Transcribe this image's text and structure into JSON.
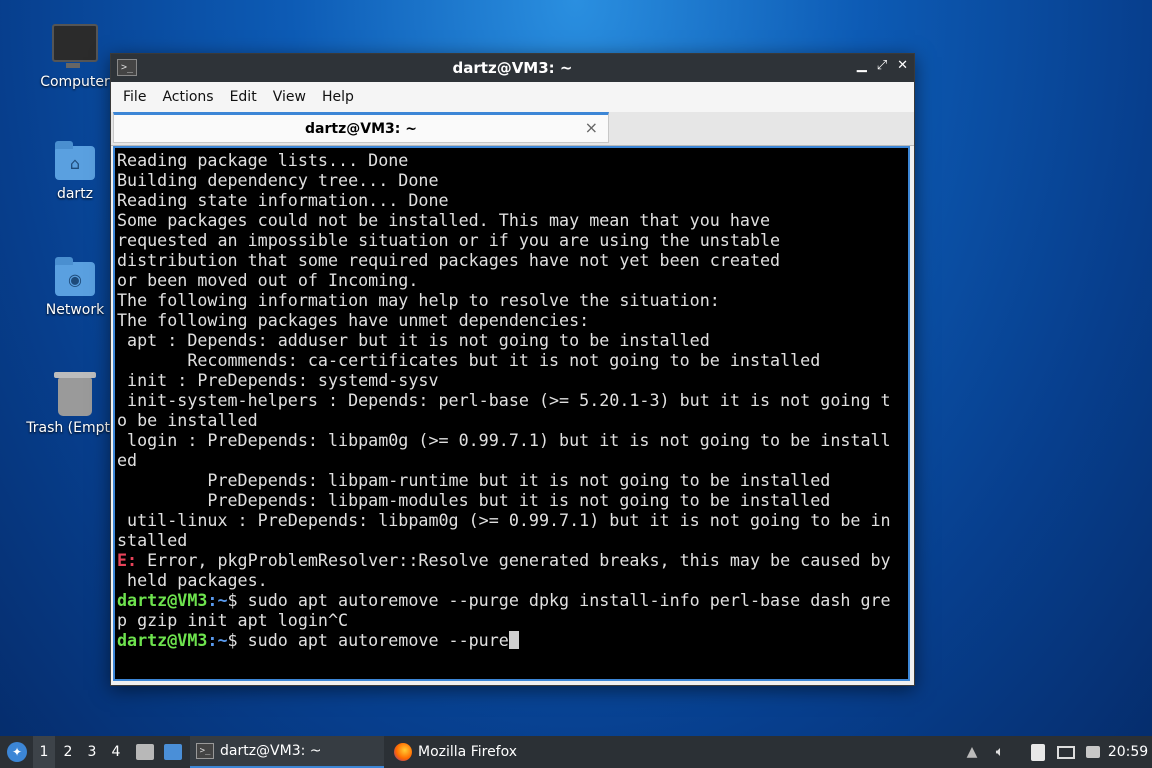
{
  "desktop": {
    "icons": [
      {
        "label": "Computer"
      },
      {
        "label": "dartz"
      },
      {
        "label": "Network"
      },
      {
        "label": "Trash (Empty)"
      }
    ]
  },
  "window": {
    "title": "dartz@VM3: ~",
    "menu": [
      "File",
      "Actions",
      "Edit",
      "View",
      "Help"
    ],
    "tab_label": "dartz@VM3: ~"
  },
  "terminal": {
    "lines": [
      "Reading package lists... Done",
      "Building dependency tree... Done",
      "Reading state information... Done",
      "Some packages could not be installed. This may mean that you have",
      "requested an impossible situation or if you are using the unstable",
      "distribution that some required packages have not yet been created",
      "or been moved out of Incoming.",
      "The following information may help to resolve the situation:",
      "",
      "The following packages have unmet dependencies:",
      " apt : Depends: adduser but it is not going to be installed",
      "       Recommends: ca-certificates but it is not going to be installed",
      " init : PreDepends: systemd-sysv",
      " init-system-helpers : Depends: perl-base (>= 5.20.1-3) but it is not going t",
      "o be installed",
      " login : PreDepends: libpam0g (>= 0.99.7.1) but it is not going to be install",
      "ed",
      "         PreDepends: libpam-runtime but it is not going to be installed",
      "         PreDepends: libpam-modules but it is not going to be installed",
      " util-linux : PreDepends: libpam0g (>= 0.99.7.1) but it is not going to be in",
      "stalled"
    ],
    "error_prefix": "E:",
    "error_line1": " Error, pkgProblemResolver::Resolve generated breaks, this may be caused by",
    "error_line2": " held packages.",
    "prompt_user": "dartz@VM3",
    "prompt_path": ":~",
    "prompt_symbol": "$",
    "cmd1_a": " sudo apt autoremove --purge dpkg install-info perl-base dash gre",
    "cmd1_b": "p gzip init apt login^C",
    "cmd2": " sudo apt autoremove --pure"
  },
  "taskbar": {
    "workspaces": [
      "1",
      "2",
      "3",
      "4"
    ],
    "active_workspace": "1",
    "apps": [
      {
        "label": "dartz@VM3: ~",
        "icon": "terminal-icon",
        "active": true
      },
      {
        "label": "Mozilla Firefox",
        "icon": "firefox-icon",
        "active": false
      }
    ],
    "clock": "20:59"
  }
}
